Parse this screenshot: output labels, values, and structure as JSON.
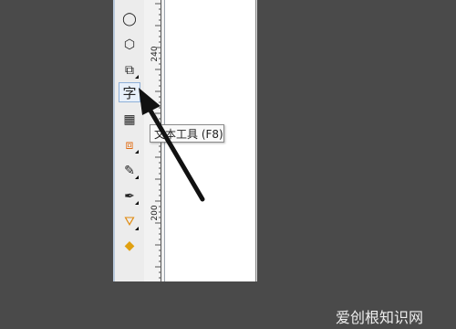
{
  "toolbox": {
    "tools": [
      {
        "name": "ellipse-tool",
        "icon": "ellipse-icon",
        "glyph": "◯"
      },
      {
        "name": "polygon-tool",
        "icon": "polygon-icon",
        "glyph": "⬡"
      },
      {
        "name": "basic-shapes-tool",
        "icon": "basic-shapes-icon",
        "glyph": "⧉"
      },
      {
        "name": "text-tool",
        "icon": "text-icon",
        "glyph": "字",
        "active": true
      },
      {
        "name": "table-tool",
        "icon": "table-icon",
        "glyph": "▦"
      },
      {
        "name": "interactive-tool",
        "icon": "blend-icon",
        "glyph": "⧈"
      },
      {
        "name": "eyedropper-tool",
        "icon": "eyedropper-icon",
        "glyph": "✎"
      },
      {
        "name": "outline-pen-tool",
        "icon": "pen-nib-icon",
        "glyph": "✒"
      },
      {
        "name": "fill-tool",
        "icon": "paint-bucket-icon",
        "glyph": "⛛"
      },
      {
        "name": "interactive-fill-tool",
        "icon": "interactive-fill-icon",
        "glyph": "◆"
      }
    ]
  },
  "ruler": {
    "labels": [
      "240",
      "200"
    ]
  },
  "tooltip": {
    "text": "文本工具 (F8)"
  },
  "watermark": {
    "text": "爱创根知识网"
  }
}
